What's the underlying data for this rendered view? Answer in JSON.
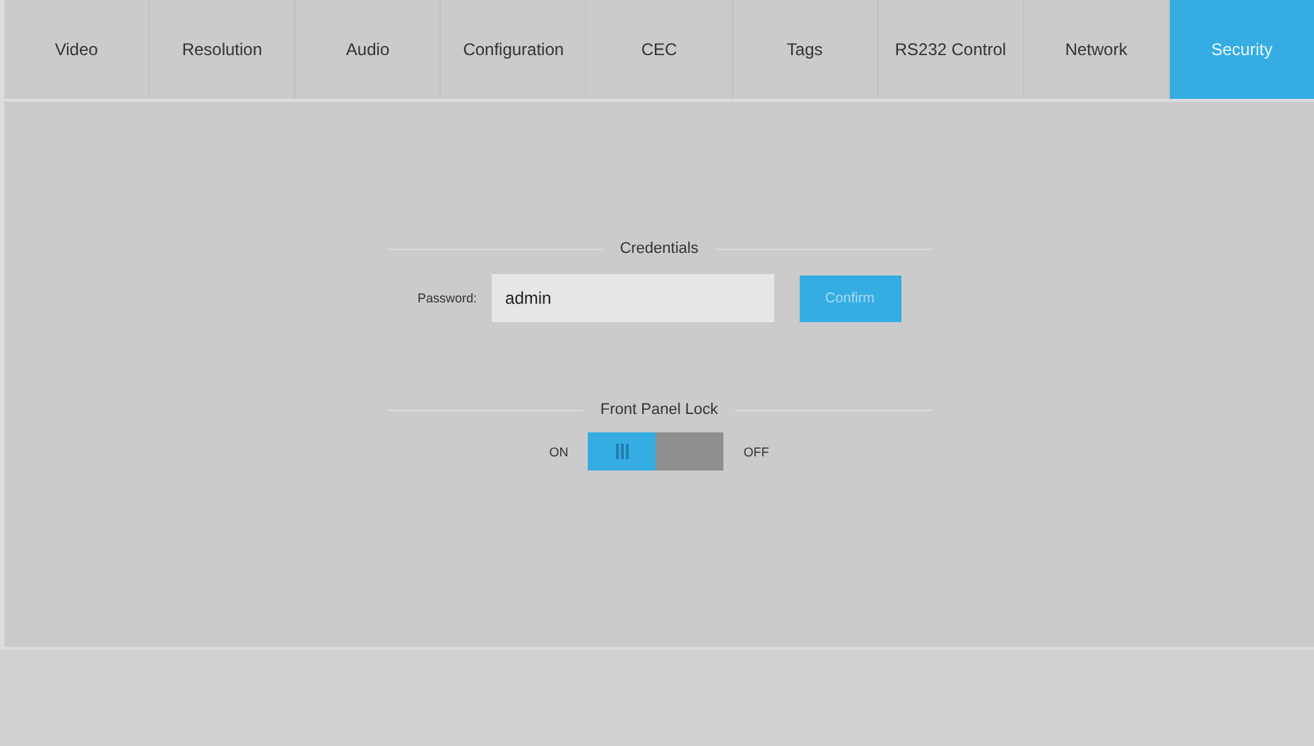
{
  "tabs": [
    {
      "label": "Video",
      "selected": false
    },
    {
      "label": "Resolution",
      "selected": false
    },
    {
      "label": "Audio",
      "selected": false
    },
    {
      "label": "Configuration",
      "selected": false
    },
    {
      "label": "CEC",
      "selected": false
    },
    {
      "label": "Tags",
      "selected": false
    },
    {
      "label": "RS232 Control",
      "selected": false
    },
    {
      "label": "Network",
      "selected": false
    },
    {
      "label": "Security",
      "selected": true
    }
  ],
  "credentials": {
    "heading": "Credentials",
    "password_label": "Password:",
    "password_value": "admin",
    "confirm_button": "Confirm"
  },
  "front_panel_lock": {
    "heading": "Front Panel Lock",
    "on_label": "ON",
    "off_label": "OFF",
    "on": true
  }
}
